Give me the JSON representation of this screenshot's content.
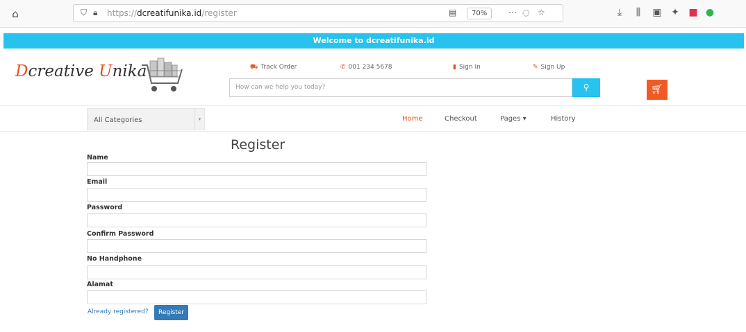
{
  "browser": {
    "url_scheme": "https://",
    "url_host": "dcreatifunika.id",
    "url_path": "/register",
    "zoom": "70%"
  },
  "banner": {
    "text": "Welcome to dcreatifunika.id"
  },
  "header": {
    "logo_first_cap": "D",
    "logo_first_rest": "creative ",
    "logo_second_cap": "U",
    "logo_second_rest": "nika",
    "links": {
      "track_order": "Track Order",
      "phone": "001 234 5678",
      "sign_in": "Sign In",
      "sign_up": "Sign Up"
    },
    "search_placeholder": "How can we help you today?"
  },
  "nav": {
    "category_selected": "All Categories",
    "items": [
      "Home",
      "Checkout",
      "Pages",
      "History"
    ]
  },
  "form": {
    "title": "Register",
    "fields": [
      {
        "label": "Name"
      },
      {
        "label": "Email"
      },
      {
        "label": "Password"
      },
      {
        "label": "Confirm Password"
      },
      {
        "label": "No Handphone"
      },
      {
        "label": "Alamat"
      }
    ],
    "already_link": "Already registered?",
    "submit_label": "Register"
  },
  "colors": {
    "accent_blue": "#27c2ee",
    "accent_orange": "#f15a24",
    "button_blue": "#337ab7"
  }
}
